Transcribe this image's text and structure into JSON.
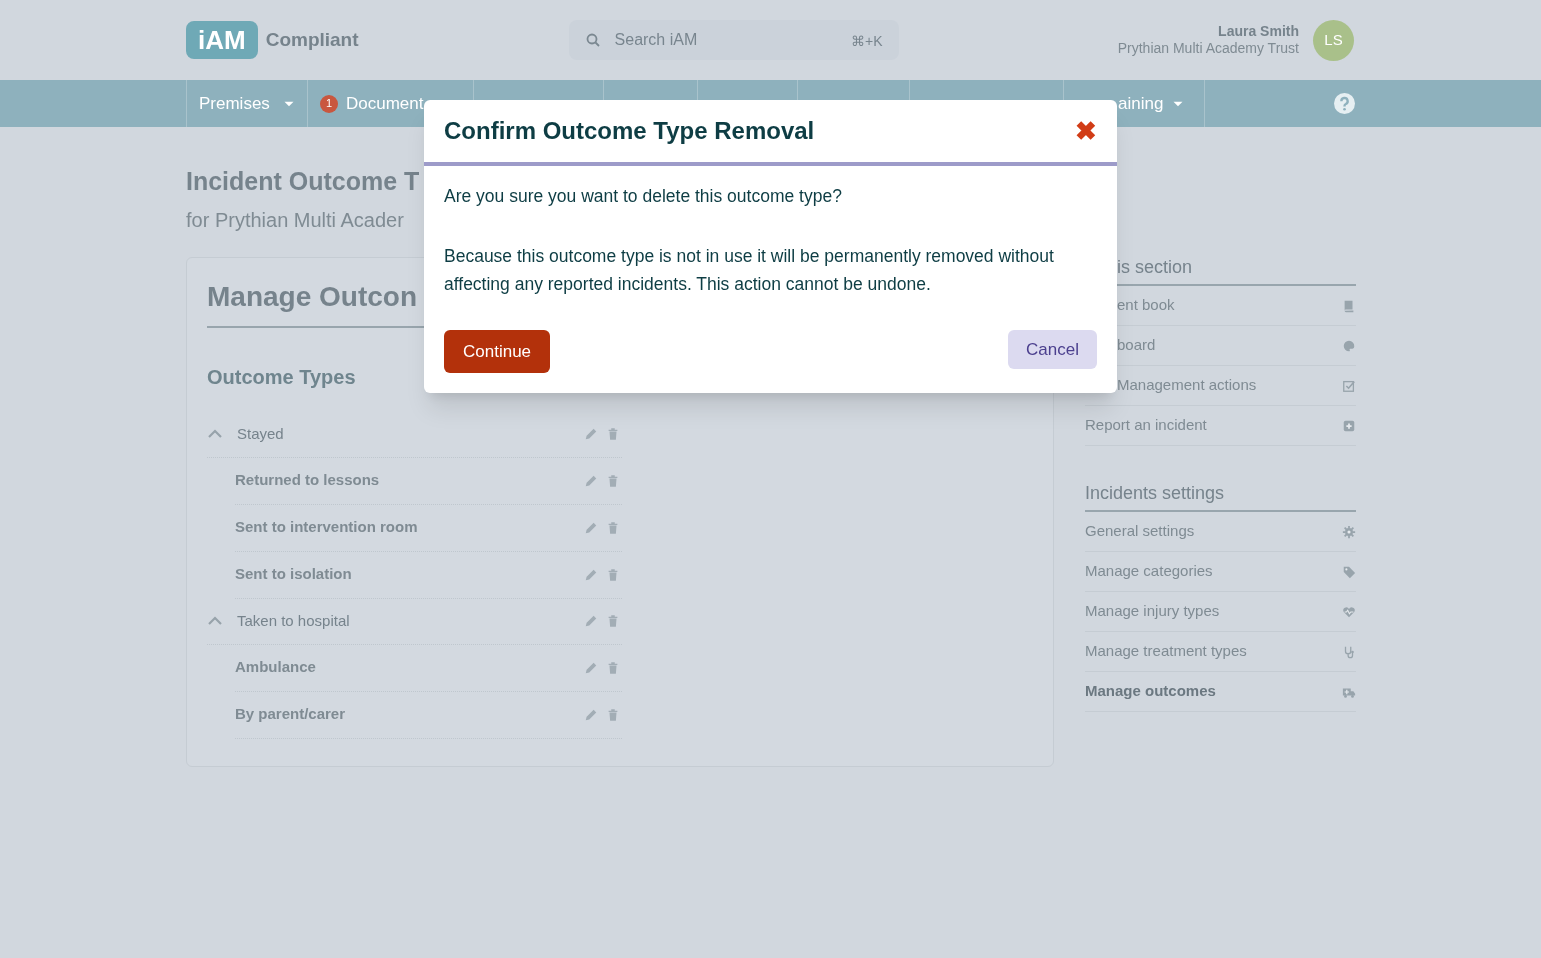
{
  "header": {
    "logo": "iAM",
    "product": "Compliant",
    "search": {
      "placeholder": "Search iAM",
      "shortcut": "⌘+K"
    },
    "user": {
      "name": "Laura Smith",
      "organisation": "Prythian Multi Academy Trust",
      "initials": "LS"
    }
  },
  "nav": [
    {
      "label": "Premises",
      "dropdown": true,
      "partly_hidden": false
    },
    {
      "label": "Document",
      "badge": "1",
      "partly_hidden": false
    },
    {
      "label": "aining",
      "dropdown": true,
      "partly_hidden": true
    }
  ],
  "page": {
    "title": "Incident Outcome T",
    "subtitle": "for Prythian Multi Acader"
  },
  "card": {
    "title": "Manage Outcon",
    "section": "Outcome Types",
    "outcome_types": [
      {
        "label": "Stayed",
        "expanded": true,
        "children": [
          {
            "label": "Returned to lessons"
          },
          {
            "label": "Sent to intervention room"
          },
          {
            "label": "Sent to isolation"
          }
        ]
      },
      {
        "label": "Taken to hospital",
        "expanded": true,
        "children": [
          {
            "label": "Ambulance"
          },
          {
            "label": "By parent/carer"
          }
        ]
      }
    ]
  },
  "sidebar": [
    {
      "heading": "is section",
      "partly_hidden": true,
      "items": [
        {
          "label": "ent book",
          "partly_hidden": true,
          "selected": false
        },
        {
          "label": "board",
          "partly_hidden": true,
          "selected": false
        },
        {
          "label": "Management actions",
          "partly_hidden": true,
          "selected": false
        },
        {
          "label": "Report an incident",
          "partly_hidden": false,
          "selected": false
        }
      ]
    },
    {
      "heading": "Incidents settings",
      "partly_hidden": false,
      "items": [
        {
          "label": "General settings",
          "partly_hidden": false,
          "selected": false
        },
        {
          "label": "Manage categories",
          "partly_hidden": false,
          "selected": false
        },
        {
          "label": "Manage injury types",
          "partly_hidden": false,
          "selected": false
        },
        {
          "label": "Manage treatment types",
          "partly_hidden": false,
          "selected": false
        },
        {
          "label": "Manage outcomes",
          "partly_hidden": false,
          "selected": true
        }
      ]
    }
  ],
  "dialog": {
    "title": "Confirm Outcome Type Removal",
    "close": "✖",
    "question": "Are you sure you want to delete this outcome type?",
    "message": "Because this outcome type is not in use it will be permanently removed without affecting any reported incidents. This action cannot be undone.",
    "buttons": [
      {
        "label": "Continue",
        "kind": "primary"
      },
      {
        "label": "Cancel",
        "kind": "secondary"
      }
    ]
  }
}
